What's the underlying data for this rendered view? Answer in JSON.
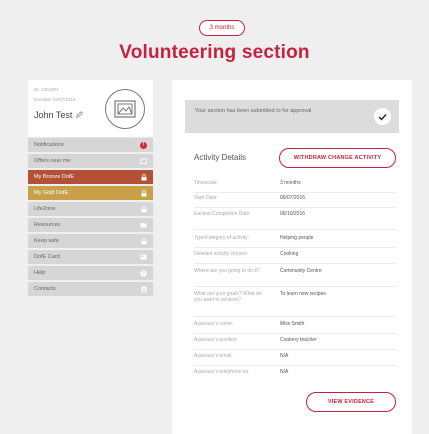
{
  "page": {
    "pill": "3 months",
    "title": "Volunteering section"
  },
  "profile": {
    "id": "ID: 1304304",
    "enrolled": "Enrolled: 04/07/2016",
    "name": "John Test"
  },
  "menu": [
    {
      "label": "Notifications",
      "icon": "alert-badge-icon",
      "badge": "!"
    },
    {
      "label": "Offers near me",
      "icon": "offers-icon"
    },
    {
      "label": "My Bronze DofE",
      "icon": "lock-icon",
      "state": "bronze"
    },
    {
      "label": "My Gold DofE",
      "icon": "lock-icon",
      "state": "gold"
    },
    {
      "label": "LifeZone",
      "icon": "lifezone-icon"
    },
    {
      "label": "Resources",
      "icon": "folder-icon"
    },
    {
      "label": "Keep safe",
      "icon": "padlock-icon"
    },
    {
      "label": "DofE Card",
      "icon": "card-icon"
    },
    {
      "label": "Help",
      "icon": "help-icon"
    },
    {
      "label": "Contacts",
      "icon": "contact-icon"
    }
  ],
  "notice": {
    "text": "Your section has been submitted to for approval"
  },
  "activity": {
    "heading": "Activity Details",
    "withdraw_label": "WITHDRAW CHANGE ACTIVITY",
    "evidence_label": "VIEW EVIDENCE",
    "rows": [
      {
        "label": "Timescale:",
        "value": "3 months"
      },
      {
        "label": "Start Date:",
        "value": "06/07/2016"
      },
      {
        "label": "Earliest Completion Date:",
        "value": "06/10/2016"
      },
      {
        "label": "Type/category of activity:",
        "value": "Helping people"
      },
      {
        "label": "Detailed activity chosen:",
        "value": "Cooking"
      },
      {
        "label": "Where are you going to do it?",
        "value": "Community Centre"
      },
      {
        "label": "What are your goals? What do you want to achieve?",
        "value": "To learn new recipes"
      },
      {
        "label": "Assessor's name:",
        "value": "Miss Smith"
      },
      {
        "label": "Assessor's position:",
        "value": "Cookery teacher"
      },
      {
        "label": "Assessor's email:",
        "value": "N/A"
      },
      {
        "label": "Assessor's telephone no:",
        "value": "N/A"
      }
    ]
  },
  "colors": {
    "accent": "#c8203f",
    "bronze": "#b35137",
    "gold": "#c9a04a"
  }
}
